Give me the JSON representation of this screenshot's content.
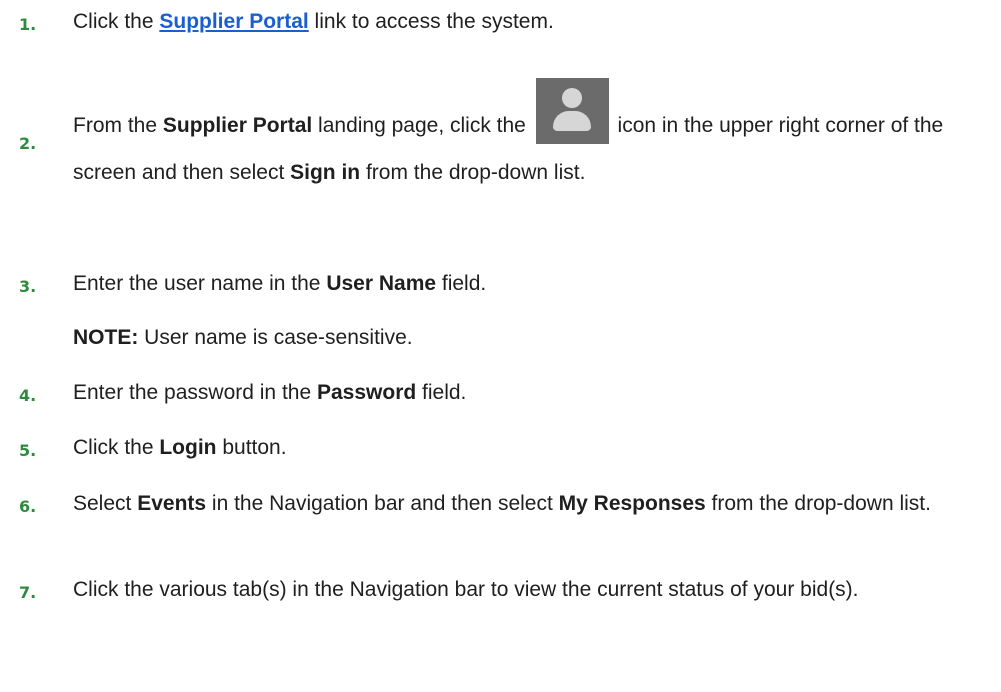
{
  "steps": [
    {
      "number": "1.",
      "segments": [
        "Click the ",
        "Supplier Portal",
        " link to access the system."
      ]
    },
    {
      "number": "2.",
      "segments": [
        "From the ",
        "Supplier Portal",
        " landing page, click the ",
        " icon in the upper right corner of the screen and then select ",
        "Sign in",
        " from the drop-down list."
      ],
      "icon": "user-icon"
    },
    {
      "number": "3.",
      "segments": [
        "Enter the user name in the ",
        "User Name",
        " field."
      ]
    },
    {
      "note_label": "NOTE:",
      "note_text": " User name is case-sensitive."
    },
    {
      "number": "4.",
      "segments": [
        "Enter the password in the ",
        "Password",
        " field."
      ]
    },
    {
      "number": "5.",
      "segments": [
        "Click the ",
        "Login",
        " button."
      ]
    },
    {
      "number": "6.",
      "segments": [
        "Select ",
        "Events",
        " in the Navigation bar and then select ",
        "My Responses",
        " from the drop-down list."
      ]
    },
    {
      "number": "7.",
      "segments": [
        "Click the various tab(s) in the Navigation bar to view the current status of your bid(s)."
      ]
    }
  ],
  "colors": {
    "step_number": "#2e8b3e",
    "link": "#1a5fd0",
    "text": "#1f1f1f",
    "icon_bg": "#6b6b6b"
  }
}
